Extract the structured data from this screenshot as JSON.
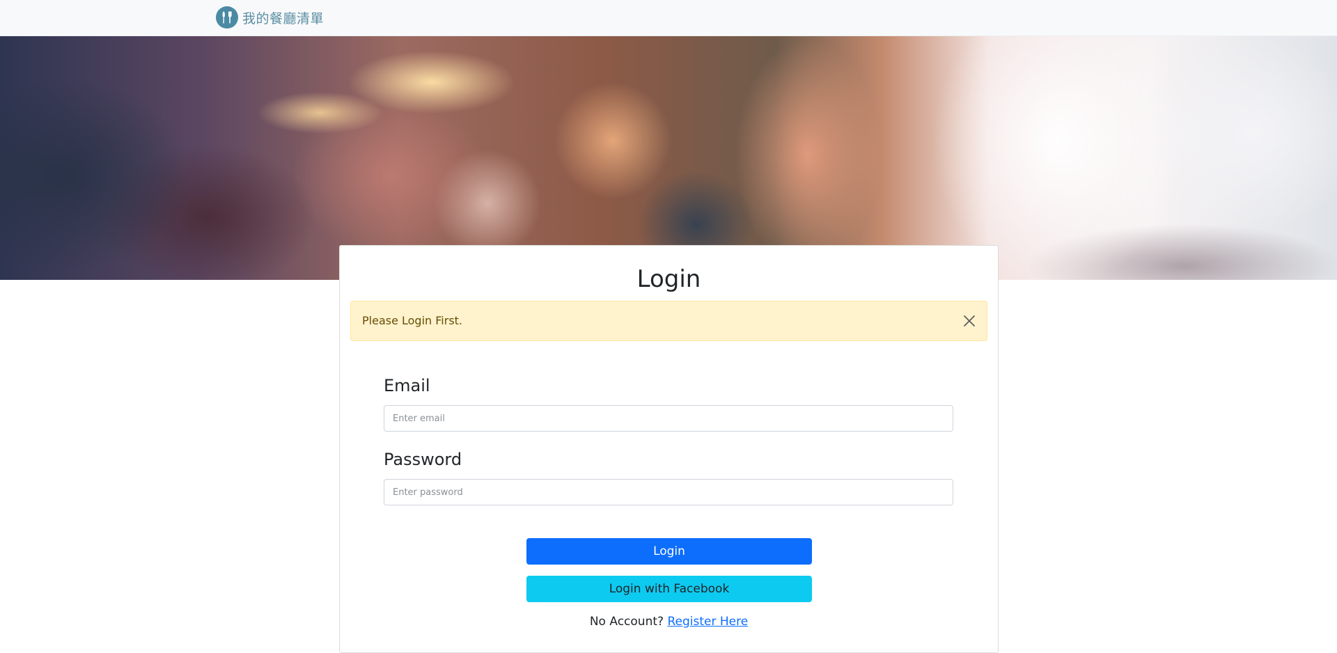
{
  "navbar": {
    "brand_text": "我的餐廳清單",
    "logo_icon": "utensils-icon",
    "logo_color": "#4a8aa3"
  },
  "banner": {
    "image": "blurred-restaurant-interior"
  },
  "login_card": {
    "title": "Login",
    "alert": {
      "message": "Please Login First.",
      "close_icon": "close-icon",
      "background": "#fff3cd"
    },
    "email": {
      "label": "Email",
      "placeholder": "Enter email",
      "value": ""
    },
    "password": {
      "label": "Password",
      "placeholder": "Enter password",
      "value": ""
    },
    "login_button": "Login",
    "facebook_button": "Login with Facebook",
    "register_prompt": "No Account?",
    "register_link": "Register Here"
  },
  "colors": {
    "primary": "#0d6efd",
    "info": "#0dcaf0"
  }
}
